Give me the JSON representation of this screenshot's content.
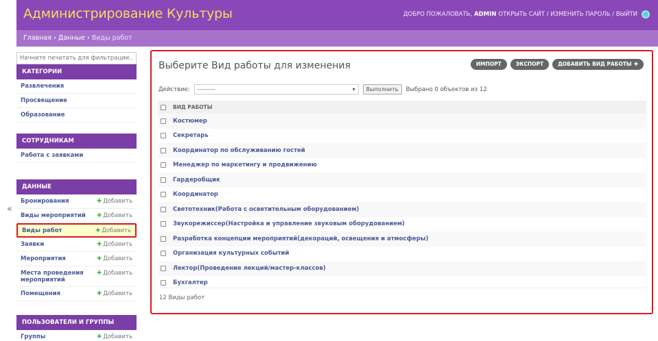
{
  "header": {
    "title": "Администрирование Культуры",
    "welcome": "ДОБРО ПОЖАЛОВАТЬ,",
    "user": "ADMIN",
    "links": "ОТКРЫТЬ САЙТ / ИЗМЕНИТЬ ПАРОЛЬ / ВЫЙТИ",
    "theme_icon": "theme-toggle-icon"
  },
  "breadcrumbs": {
    "home": "Главная",
    "sep": "›",
    "data": "Данные",
    "current": "Виды работ"
  },
  "sidebar": {
    "filter_placeholder": "Начните печатать для фильтрации...",
    "collapse_icon": "«",
    "add_label": "Добавить",
    "modules": [
      {
        "caption": "КАТЕГОРИИ",
        "items": [
          "Развлечения",
          "Просвещение",
          "Образование"
        ]
      },
      {
        "caption": "СОТРУДНИКАМ",
        "items": [
          "Работа с заявками"
        ]
      },
      {
        "caption": "ДАННЫЕ",
        "items": [
          "Бронирования",
          "Виды мероприятий",
          "Виды работ",
          "Заявки",
          "Мероприятия",
          "Места проведения мероприятий",
          "Помещения"
        ]
      },
      {
        "caption": "ПОЛЬЗОВАТЕЛИ И ГРУППЫ",
        "items": [
          "Группы"
        ]
      }
    ]
  },
  "content": {
    "title": "Выберите Вид работы для изменения",
    "tools": {
      "import": "ИМПОРТ",
      "export": "ЭКСПОРТ",
      "add": "ДОБАВИТЬ ВИД РАБОТЫ"
    },
    "action_label": "Действие:",
    "action_value": "---------",
    "go_button": "Выполнить",
    "selected_text": "Выбрано 0 объектов из 12",
    "column_header": "ВИД РАБОТЫ",
    "rows": [
      "Костюмер",
      "Секретарь",
      "Координатор по обслуживанию гостей",
      "Менеджер по маркетингу и продвижению",
      "Гардеробщик",
      "Координатор",
      "Светотехник(Работа с осветительным оборудованием)",
      "Звукорежиссер(Настройка и управление звуковым оборудованием)",
      "Разработка концепции мероприятий(декораций, освещения и атмосферы)",
      "Организация культурных событий",
      "Лектор(Проведение лекций/мастер-классов)",
      "Бухгалтер"
    ],
    "count_text": "12 Виды работ"
  },
  "colors": {
    "header": "#8a47b8",
    "breadcrumbs": "#a772cc",
    "caption": "#7a3ea6",
    "title": "#f5dd5d",
    "highlight": "#d7191f"
  }
}
